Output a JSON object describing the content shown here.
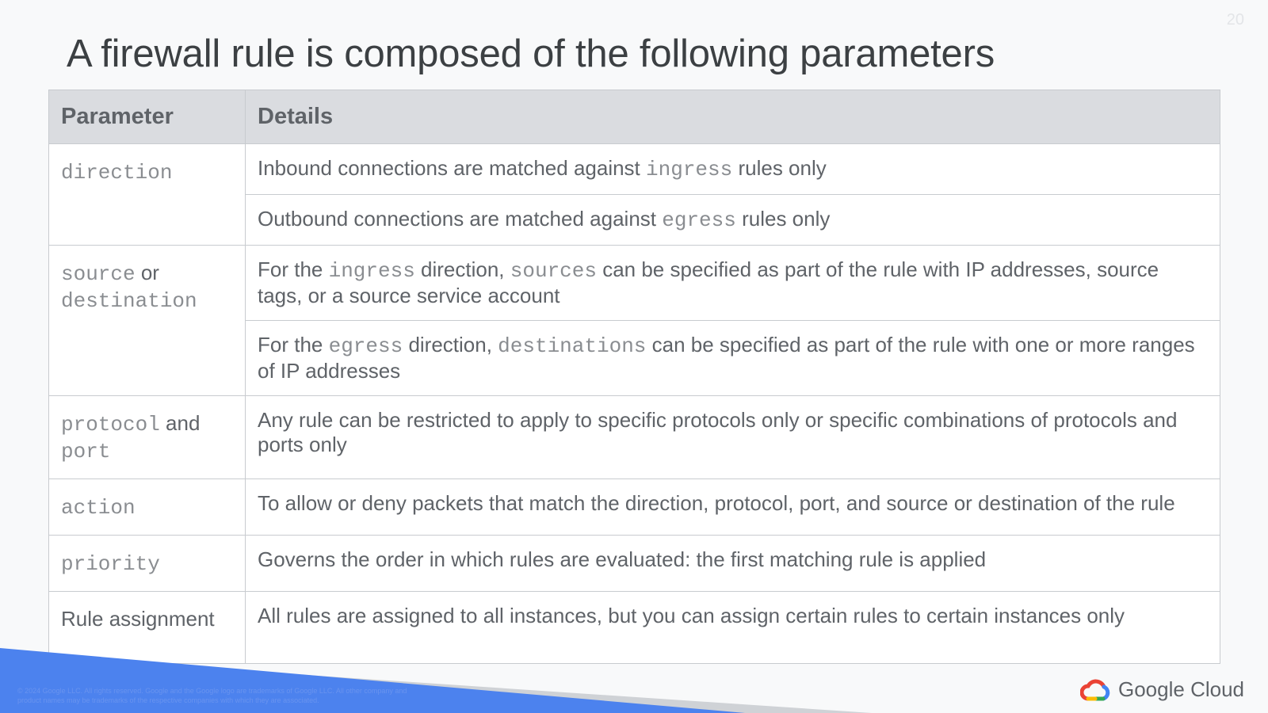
{
  "page_number": "20",
  "title": "A firewall rule is composed of the following parameters",
  "table": {
    "headers": {
      "parameter": "Parameter",
      "details": "Details"
    },
    "direction": {
      "param": "direction",
      "inbound": {
        "a": "Inbound connections are matched against ",
        "code": "ingress",
        "b": " rules only"
      },
      "outbound": {
        "a": "Outbound connections are matched against ",
        "code": "egress",
        "b": " rules only"
      }
    },
    "source_destination": {
      "param_code1": "source",
      "param_join": " or ",
      "param_code2": "destination",
      "ingress": {
        "a": "For the ",
        "code1": "ingress",
        "b": " direction, ",
        "code2": "sources",
        "c": " can be specified as part of the rule with IP addresses, source tags, or a source service account"
      },
      "egress": {
        "a": "For the ",
        "code1": "egress",
        "b": " direction, ",
        "code2": "destinations",
        "c": " can be specified as part of the rule with one or more ranges of IP addresses"
      }
    },
    "protocol_port": {
      "param_code1": "protocol",
      "param_join": " and ",
      "param_code2": "port",
      "detail": "Any rule can be restricted to apply to specific protocols only or specific combinations of protocols and ports only"
    },
    "action": {
      "param": "action",
      "detail": "To allow or deny packets that match the direction, protocol, port, and source or destination of the rule"
    },
    "priority": {
      "param": "priority",
      "detail": "Governs the order in which rules are evaluated: the first matching rule is applied"
    },
    "rule_assignment": {
      "param": "Rule assignment",
      "detail": "All rules are assigned to all instances, but you can assign certain rules to certain instances only"
    }
  },
  "footer": {
    "legal": "© 2024 Google LLC. All rights reserved. Google and the Google logo are trademarks of Google LLC. All other company and product names may be trademarks of the respective companies with which they are associated.",
    "logo_text": "Google Cloud"
  },
  "colors": {
    "band_blue": "#4c82ee",
    "band_gray": "#cfd2d6",
    "header_bg": "#dadce0",
    "logo_red": "#ea4335",
    "logo_yellow": "#fbbc04",
    "logo_green": "#34a853",
    "logo_blue": "#4285f4"
  }
}
